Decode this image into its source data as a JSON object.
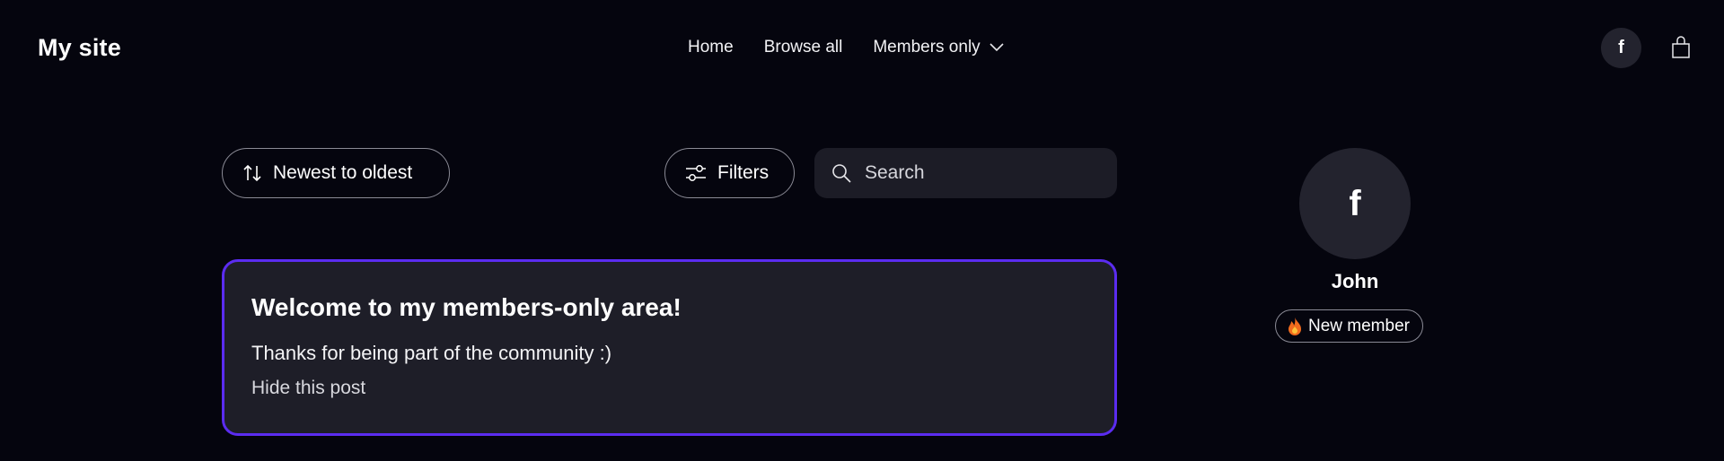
{
  "header": {
    "site_title": "My site",
    "nav": [
      {
        "label": "Home"
      },
      {
        "label": "Browse all"
      },
      {
        "label": "Members only",
        "has_dropdown": true
      }
    ],
    "avatar_initial": "f"
  },
  "toolbar": {
    "sort_label": "Newest to oldest",
    "filters_label": "Filters",
    "search_placeholder": "Search"
  },
  "post": {
    "title": "Welcome to my members-only area!",
    "body": "Thanks for being part of the community :)",
    "hide_label": "Hide this post"
  },
  "profile": {
    "avatar_initial": "f",
    "name": "John",
    "badge": "New member"
  },
  "colors": {
    "background": "#05050e",
    "card": "#1e1e28",
    "accent_border": "#5b2cf0"
  }
}
